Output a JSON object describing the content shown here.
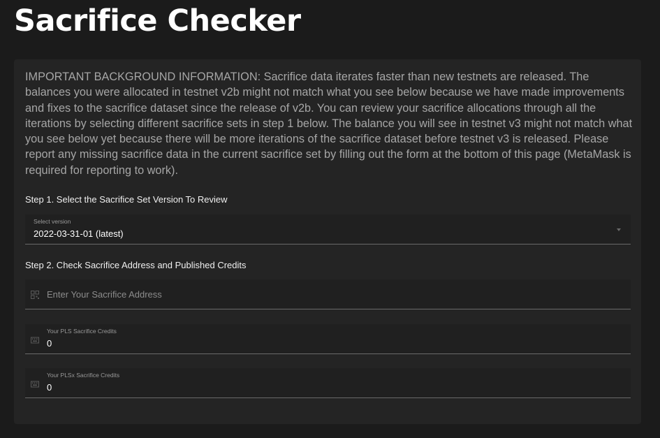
{
  "header": {
    "title": "Sacrifice Checker"
  },
  "info": {
    "text": "IMPORTANT BACKGROUND INFORMATION: Sacrifice data iterates faster than new testnets are released. The balances you were allocated in testnet v2b might not match what you see below because we have made improvements and fixes to the sacrifice dataset since the release of v2b. You can review your sacrifice allocations through all the iterations by selecting different sacrifice sets in step 1 below. The balance you will see in testnet v3 might not match what you see below yet because there will be more iterations of the sacrifice dataset before testnet v3 is released. Please report any missing sacrifice data in the current sacrifice set by filling out the form at the bottom of this page (MetaMask is required for reporting to work)."
  },
  "step1": {
    "label": "Step 1. Select the Sacrifice Set Version To Review",
    "select": {
      "label": "Select version",
      "value": "2022-03-31-01 (latest)"
    }
  },
  "step2": {
    "label": "Step 2. Check Sacrifice Address and Published Credits",
    "address": {
      "placeholder": "Enter Your Sacrifice Address",
      "icon": "qr-code-icon"
    },
    "pls": {
      "label": "Your PLS Sacrifice Credits",
      "value": "0",
      "icon": "keyboard-icon"
    },
    "plsx": {
      "label": "Your PLSx Sacrifice Credits",
      "value": "0",
      "icon": "keyboard-icon"
    }
  },
  "colors": {
    "background": "#1b1b1b",
    "card": "#242424",
    "field": "#202020",
    "text_muted": "#a6a6a6"
  }
}
